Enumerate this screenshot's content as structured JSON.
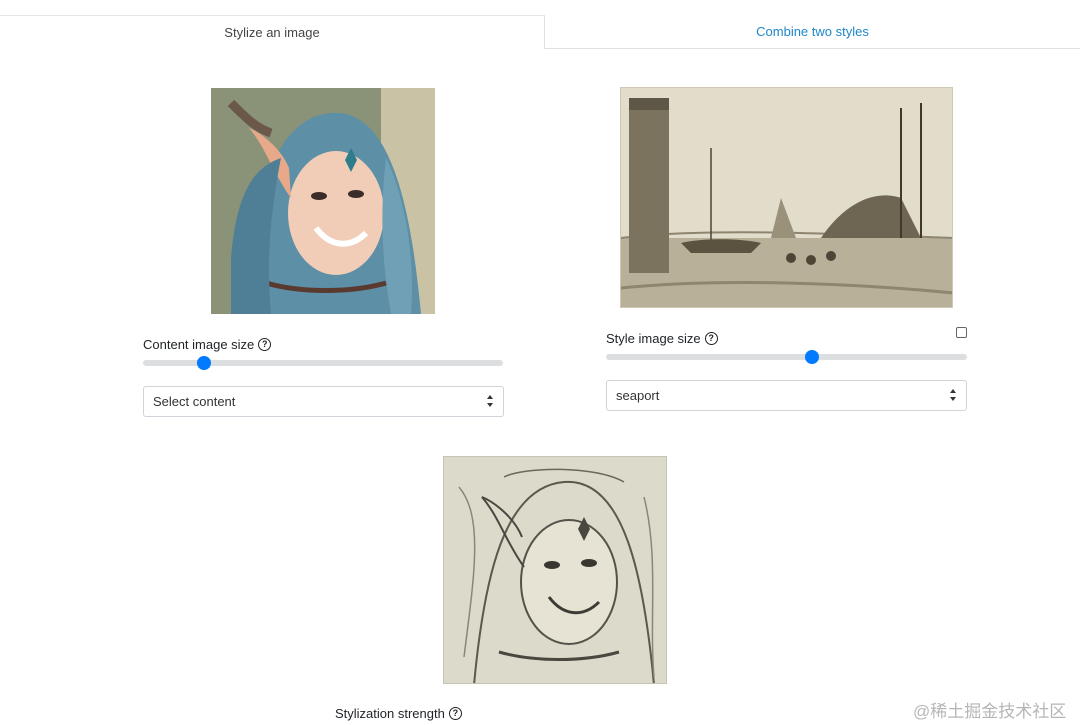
{
  "tabs": [
    {
      "label": "Stylize an image",
      "active": true
    },
    {
      "label": "Combine two styles",
      "active": false
    }
  ],
  "content": {
    "size_label": "Content image size",
    "slider_value": 0.17,
    "select_value": "Select content"
  },
  "style": {
    "size_label": "Style image size",
    "slider_value": 0.57,
    "select_value": "seaport",
    "checkbox_checked": false
  },
  "result": {
    "strength_label": "Stylization strength"
  },
  "icons": {
    "help": "question-circle-icon"
  },
  "colors": {
    "accent": "#007bff",
    "tab_link": "#1e87c8"
  },
  "watermark": "@稀土掘金技术社区"
}
